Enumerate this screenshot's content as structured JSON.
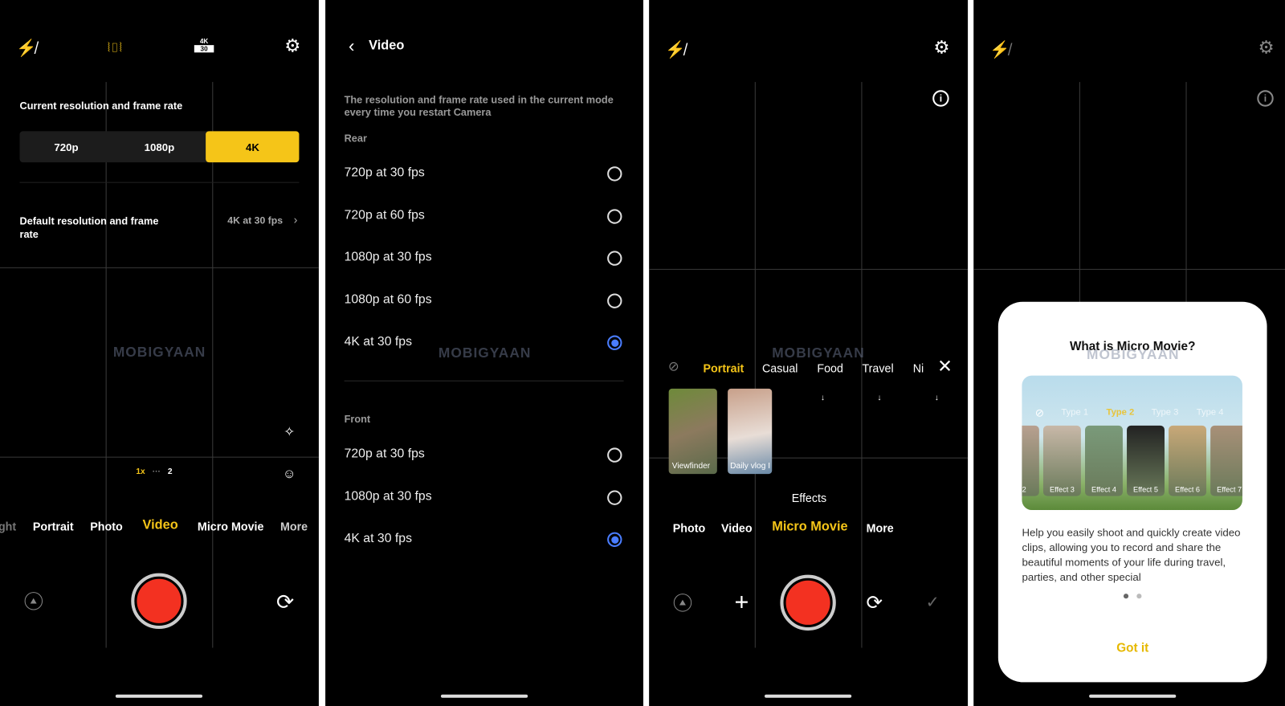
{
  "panel1": {
    "top_icons": [
      "flash-off-icon",
      "stabilization-icon",
      "resolution-badge-icon",
      "gear-icon"
    ],
    "res_badge": {
      "top": "4K",
      "bottom": "30"
    },
    "current_label": "Current resolution and frame rate",
    "segments": [
      "720p",
      "1080p",
      "4K"
    ],
    "selected_segment": "4K",
    "default_label": "Default resolution and frame rate",
    "default_value": "4K at 30 fps",
    "zoom": {
      "current": "1x",
      "dots": "···",
      "next": "2"
    },
    "modes": [
      "ght",
      "Portrait",
      "Photo",
      "Video",
      "Micro Movie",
      "More"
    ],
    "selected_mode": "Video",
    "watermark": "MOBIGYAAN"
  },
  "panel2": {
    "title": "Video",
    "description": "The resolution and frame rate used in the current mode every time you restart Camera",
    "rear_label": "Rear",
    "rear_options": [
      {
        "label": "720p at 30 fps",
        "selected": false
      },
      {
        "label": "720p at 60 fps",
        "selected": false
      },
      {
        "label": "1080p at 30 fps",
        "selected": false
      },
      {
        "label": "1080p at 60 fps",
        "selected": false
      },
      {
        "label": "4K at 30 fps",
        "selected": true
      }
    ],
    "front_label": "Front",
    "front_options": [
      {
        "label": "720p at 30 fps",
        "selected": false
      },
      {
        "label": "1080p at 30 fps",
        "selected": false
      },
      {
        "label": "4K at 30 fps",
        "selected": true
      }
    ],
    "watermark": "MOBIGYAAN",
    "accent": "#4a7dff"
  },
  "panel3": {
    "categories": [
      "Portrait",
      "Casual",
      "Food",
      "Travel",
      "Ni"
    ],
    "selected_category": "Portrait",
    "templates": [
      "Viewfinder",
      "Daily vlog I"
    ],
    "effects_label": "Effects",
    "modes": [
      "Photo",
      "Video",
      "Micro Movie",
      "More"
    ],
    "selected_mode": "Micro Movie",
    "watermark": "MOBIGYAAN"
  },
  "panel4": {
    "dialog_title": "What is Micro Movie?",
    "types": [
      "Type 1",
      "Type 2",
      "Type 3",
      "Type 4"
    ],
    "selected_type": "Type 2",
    "effects": [
      "ct 2",
      "Effect 3",
      "Effect 4",
      "Effect 5",
      "Effect 6",
      "Effect 7"
    ],
    "body": "Help you easily shoot and quickly create video clips, allowing you to record and share the beautiful moments of your life during travel, parties, and other special",
    "page": 1,
    "pages": 2,
    "confirm": "Got it",
    "watermark": "MOBIGYAAN"
  },
  "colors": {
    "accent_yellow": "#f5c518",
    "record_red": "#f33121",
    "background": "#000000"
  }
}
